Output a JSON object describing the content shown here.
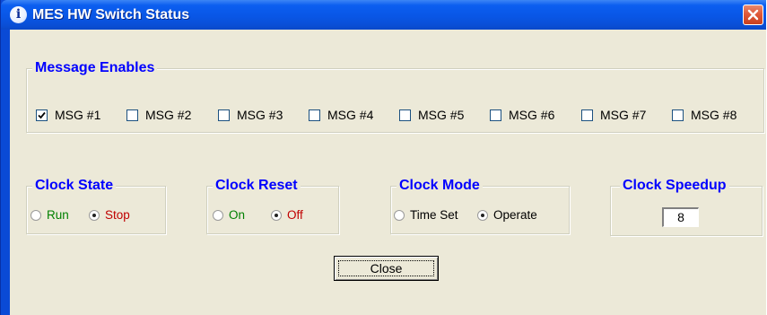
{
  "window": {
    "title": "MES HW Switch Status",
    "title_icon": "info-icon",
    "colors": {
      "titlebar": "#0a5ae6",
      "close": "#e0593a",
      "legend": "#0000ff",
      "face": "#ece9d8"
    }
  },
  "message_enables": {
    "legend": "Message Enables",
    "items": [
      {
        "label": "MSG #1",
        "checked": true
      },
      {
        "label": "MSG #2",
        "checked": false
      },
      {
        "label": "MSG #3",
        "checked": false
      },
      {
        "label": "MSG #4",
        "checked": false
      },
      {
        "label": "MSG #5",
        "checked": false
      },
      {
        "label": "MSG #6",
        "checked": false
      },
      {
        "label": "MSG #7",
        "checked": false
      },
      {
        "label": "MSG #8",
        "checked": false
      }
    ]
  },
  "clock_state": {
    "legend": "Clock State",
    "options": [
      {
        "label": "Run",
        "selected": false,
        "color": "#008000"
      },
      {
        "label": "Stop",
        "selected": true,
        "color": "#c00000"
      }
    ]
  },
  "clock_reset": {
    "legend": "Clock Reset",
    "options": [
      {
        "label": "On",
        "selected": false,
        "color": "#008000"
      },
      {
        "label": "Off",
        "selected": true,
        "color": "#c00000"
      }
    ]
  },
  "clock_mode": {
    "legend": "Clock Mode",
    "options": [
      {
        "label": "Time Set",
        "selected": false,
        "color": "#000000"
      },
      {
        "label": "Operate",
        "selected": true,
        "color": "#000000"
      }
    ]
  },
  "clock_speedup": {
    "legend": "Clock Speedup",
    "value": "8"
  },
  "buttons": {
    "close_label": "Close"
  }
}
